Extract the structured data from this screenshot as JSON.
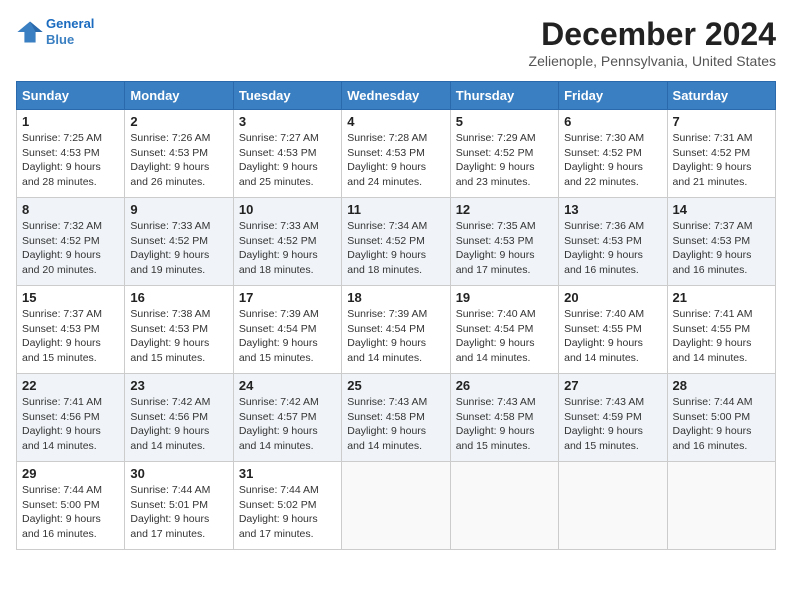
{
  "header": {
    "logo_line1": "General",
    "logo_line2": "Blue",
    "month_title": "December 2024",
    "location": "Zelienople, Pennsylvania, United States"
  },
  "days_of_week": [
    "Sunday",
    "Monday",
    "Tuesday",
    "Wednesday",
    "Thursday",
    "Friday",
    "Saturday"
  ],
  "weeks": [
    [
      {
        "day": "1",
        "sunrise": "7:25 AM",
        "sunset": "4:53 PM",
        "daylight": "9 hours and 28 minutes."
      },
      {
        "day": "2",
        "sunrise": "7:26 AM",
        "sunset": "4:53 PM",
        "daylight": "9 hours and 26 minutes."
      },
      {
        "day": "3",
        "sunrise": "7:27 AM",
        "sunset": "4:53 PM",
        "daylight": "9 hours and 25 minutes."
      },
      {
        "day": "4",
        "sunrise": "7:28 AM",
        "sunset": "4:53 PM",
        "daylight": "9 hours and 24 minutes."
      },
      {
        "day": "5",
        "sunrise": "7:29 AM",
        "sunset": "4:52 PM",
        "daylight": "9 hours and 23 minutes."
      },
      {
        "day": "6",
        "sunrise": "7:30 AM",
        "sunset": "4:52 PM",
        "daylight": "9 hours and 22 minutes."
      },
      {
        "day": "7",
        "sunrise": "7:31 AM",
        "sunset": "4:52 PM",
        "daylight": "9 hours and 21 minutes."
      }
    ],
    [
      {
        "day": "8",
        "sunrise": "7:32 AM",
        "sunset": "4:52 PM",
        "daylight": "9 hours and 20 minutes."
      },
      {
        "day": "9",
        "sunrise": "7:33 AM",
        "sunset": "4:52 PM",
        "daylight": "9 hours and 19 minutes."
      },
      {
        "day": "10",
        "sunrise": "7:33 AM",
        "sunset": "4:52 PM",
        "daylight": "9 hours and 18 minutes."
      },
      {
        "day": "11",
        "sunrise": "7:34 AM",
        "sunset": "4:52 PM",
        "daylight": "9 hours and 18 minutes."
      },
      {
        "day": "12",
        "sunrise": "7:35 AM",
        "sunset": "4:53 PM",
        "daylight": "9 hours and 17 minutes."
      },
      {
        "day": "13",
        "sunrise": "7:36 AM",
        "sunset": "4:53 PM",
        "daylight": "9 hours and 16 minutes."
      },
      {
        "day": "14",
        "sunrise": "7:37 AM",
        "sunset": "4:53 PM",
        "daylight": "9 hours and 16 minutes."
      }
    ],
    [
      {
        "day": "15",
        "sunrise": "7:37 AM",
        "sunset": "4:53 PM",
        "daylight": "9 hours and 15 minutes."
      },
      {
        "day": "16",
        "sunrise": "7:38 AM",
        "sunset": "4:53 PM",
        "daylight": "9 hours and 15 minutes."
      },
      {
        "day": "17",
        "sunrise": "7:39 AM",
        "sunset": "4:54 PM",
        "daylight": "9 hours and 15 minutes."
      },
      {
        "day": "18",
        "sunrise": "7:39 AM",
        "sunset": "4:54 PM",
        "daylight": "9 hours and 14 minutes."
      },
      {
        "day": "19",
        "sunrise": "7:40 AM",
        "sunset": "4:54 PM",
        "daylight": "9 hours and 14 minutes."
      },
      {
        "day": "20",
        "sunrise": "7:40 AM",
        "sunset": "4:55 PM",
        "daylight": "9 hours and 14 minutes."
      },
      {
        "day": "21",
        "sunrise": "7:41 AM",
        "sunset": "4:55 PM",
        "daylight": "9 hours and 14 minutes."
      }
    ],
    [
      {
        "day": "22",
        "sunrise": "7:41 AM",
        "sunset": "4:56 PM",
        "daylight": "9 hours and 14 minutes."
      },
      {
        "day": "23",
        "sunrise": "7:42 AM",
        "sunset": "4:56 PM",
        "daylight": "9 hours and 14 minutes."
      },
      {
        "day": "24",
        "sunrise": "7:42 AM",
        "sunset": "4:57 PM",
        "daylight": "9 hours and 14 minutes."
      },
      {
        "day": "25",
        "sunrise": "7:43 AM",
        "sunset": "4:58 PM",
        "daylight": "9 hours and 14 minutes."
      },
      {
        "day": "26",
        "sunrise": "7:43 AM",
        "sunset": "4:58 PM",
        "daylight": "9 hours and 15 minutes."
      },
      {
        "day": "27",
        "sunrise": "7:43 AM",
        "sunset": "4:59 PM",
        "daylight": "9 hours and 15 minutes."
      },
      {
        "day": "28",
        "sunrise": "7:44 AM",
        "sunset": "5:00 PM",
        "daylight": "9 hours and 16 minutes."
      }
    ],
    [
      {
        "day": "29",
        "sunrise": "7:44 AM",
        "sunset": "5:00 PM",
        "daylight": "9 hours and 16 minutes."
      },
      {
        "day": "30",
        "sunrise": "7:44 AM",
        "sunset": "5:01 PM",
        "daylight": "9 hours and 17 minutes."
      },
      {
        "day": "31",
        "sunrise": "7:44 AM",
        "sunset": "5:02 PM",
        "daylight": "9 hours and 17 minutes."
      },
      null,
      null,
      null,
      null
    ]
  ]
}
